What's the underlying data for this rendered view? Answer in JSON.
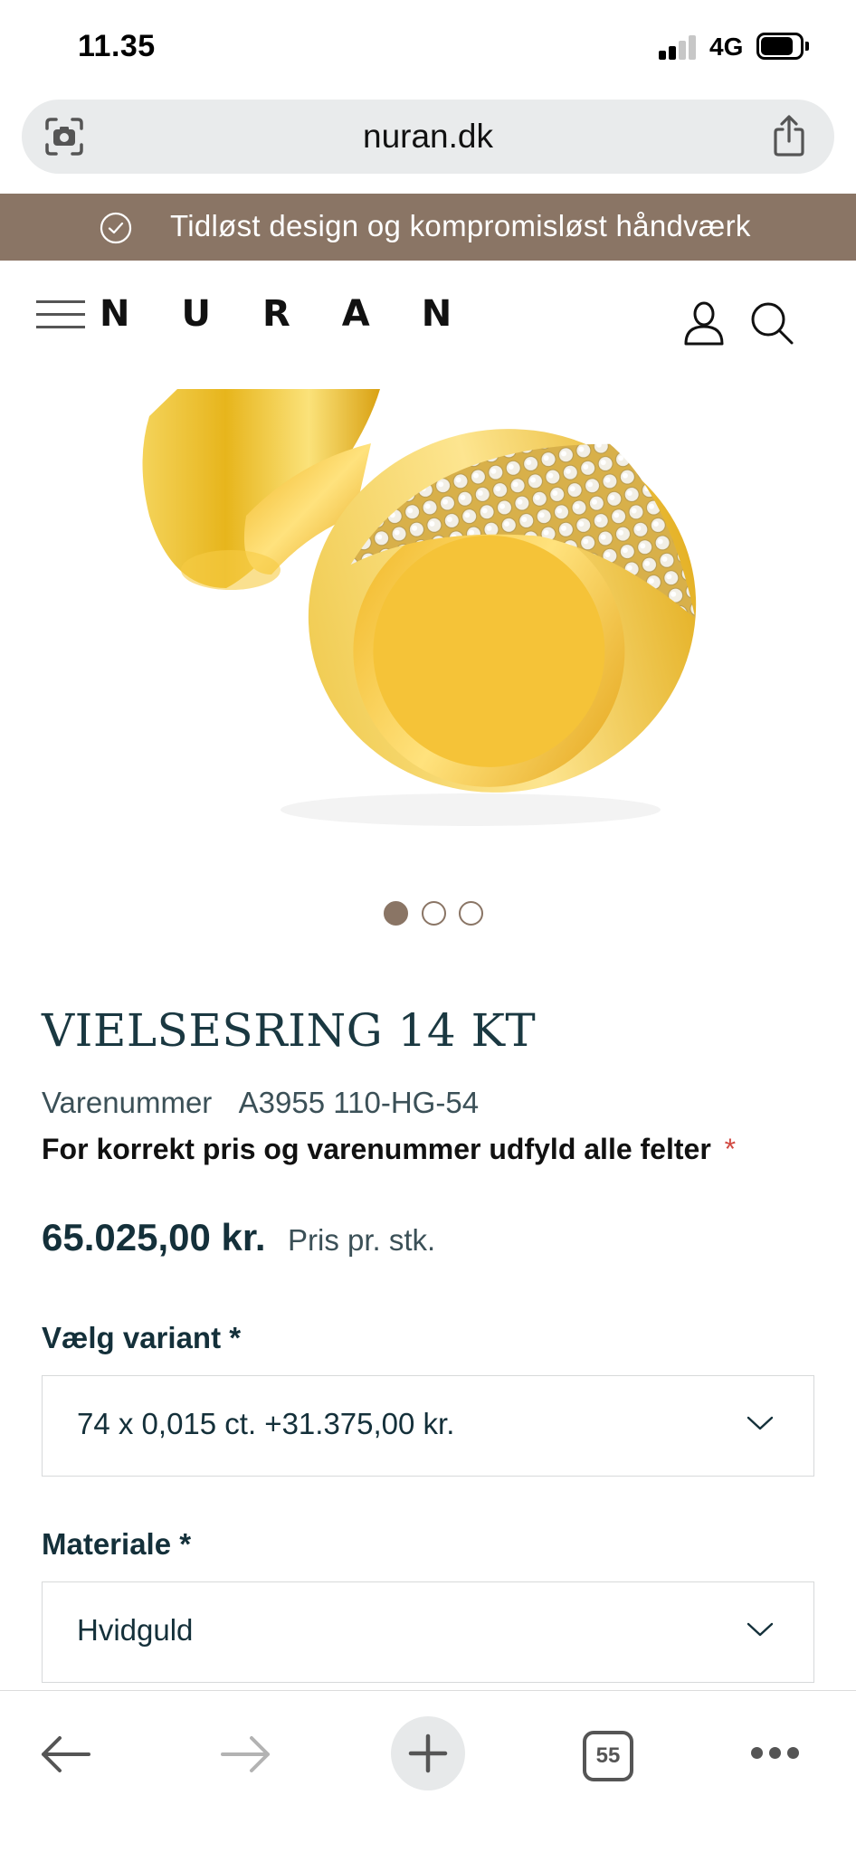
{
  "status_bar": {
    "time": "11.35",
    "network": "4G"
  },
  "browser": {
    "url": "nuran.dk",
    "tab_count": "55"
  },
  "announcement": {
    "text": "Tidløst design og kompromisløst håndværk"
  },
  "header": {
    "logo": "NURAN"
  },
  "carousel": {
    "slide_count": 3,
    "active_index": 0
  },
  "product": {
    "title": "VIELSESRING 14 KT",
    "sku_label": "Varenummer",
    "sku": "A3955 110-HG-54",
    "notice": "For korrekt pris og varenummer udfyld alle felter",
    "notice_required_mark": "*",
    "price": "65.025,00 kr.",
    "price_note": "Pris pr. stk."
  },
  "fields": {
    "variant": {
      "label": "Vælg variant *",
      "value": "74 x 0,015 ct. +31.375,00 kr."
    },
    "material": {
      "label": "Materiale *",
      "value": "Hvidguld"
    }
  },
  "colors": {
    "accent": "#8a7565",
    "title": "#1a3841",
    "required": "#d24a42",
    "gold": "#e9b81f"
  }
}
